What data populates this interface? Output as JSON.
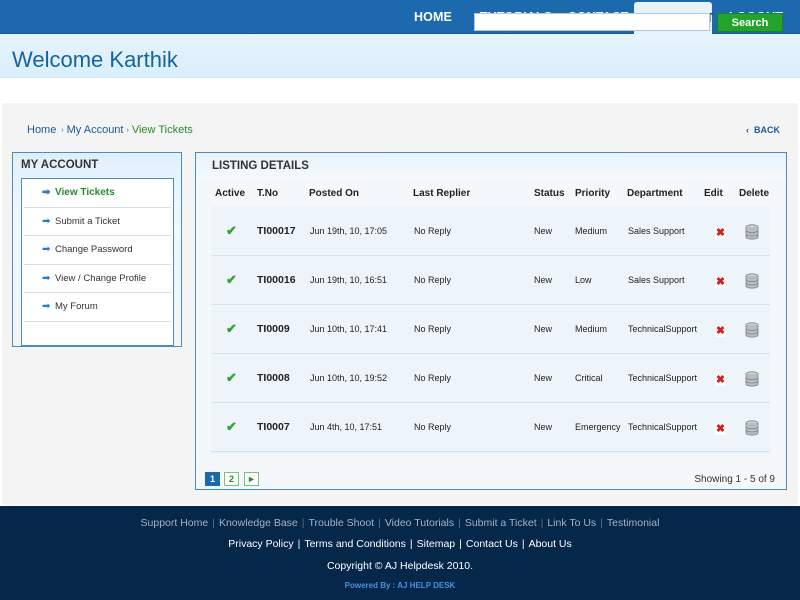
{
  "nav": {
    "items": [
      {
        "label": "HOME"
      },
      {
        "label": "TUTORIALS"
      },
      {
        "label": "CONTACT"
      },
      {
        "label": "MYACCOUNT"
      },
      {
        "label": "LOGOUT"
      }
    ],
    "active": "MYACCOUNT"
  },
  "header": {
    "welcome": "Welcome Karthik",
    "search_value": "",
    "search_button": "Search"
  },
  "breadcrumb": {
    "home": "Home",
    "myaccount": "My Account",
    "current": "View Tickets",
    "back": "BACK"
  },
  "sidebar": {
    "title": "MY ACCOUNT",
    "items": [
      {
        "label": "View Tickets"
      },
      {
        "label": "Submit a Ticket"
      },
      {
        "label": "Change Password"
      },
      {
        "label": "View / Change Profile"
      },
      {
        "label": "My Forum"
      }
    ]
  },
  "listing": {
    "title": "LISTING DETAILS",
    "columns": [
      "Active",
      "T.No",
      "Posted On",
      "Last Replier",
      "Status",
      "Priority",
      "Department",
      "Edit",
      "Delete"
    ],
    "rows": [
      {
        "tno": "TI00017",
        "posted": "Jun 19th, 10, 17:05",
        "replier": "No Reply",
        "status": "New",
        "priority": "Medium",
        "department": "Sales Support"
      },
      {
        "tno": "TI00016",
        "posted": "Jun 19th, 10, 16:51",
        "replier": "No Reply",
        "status": "New",
        "priority": "Low",
        "department": "Sales Support"
      },
      {
        "tno": "TI0009",
        "posted": "Jun 10th, 10, 17:41",
        "replier": "No Reply",
        "status": "New",
        "priority": "Medium",
        "department": "TechnicalSupport"
      },
      {
        "tno": "TI0008",
        "posted": "Jun 10th, 10, 19:52",
        "replier": "No Reply",
        "status": "New",
        "priority": "Critical",
        "department": "TechnicalSupport"
      },
      {
        "tno": "TI0007",
        "posted": "Jun 4th, 10, 17:51",
        "replier": "No Reply",
        "status": "New",
        "priority": "Emergency",
        "department": "TechnicalSupport"
      }
    ],
    "pagination": {
      "pages": [
        "1",
        "2"
      ],
      "next": "►",
      "current": "1"
    },
    "showing": "Showing 1 - 5 of 9"
  },
  "footer": {
    "links1": [
      "Support Home",
      "Knowledge Base",
      "Trouble Shoot",
      "Video Tutorials",
      "Submit a Ticket",
      "Link To Us",
      "Testimonial"
    ],
    "links2": [
      "Privacy Policy",
      "Terms and Conditions",
      "Sitemap",
      "Contact Us",
      "About Us"
    ],
    "copyright": "Copyright © AJ Helpdesk 2010.",
    "powered": "Powered By : AJ HELP DESK"
  },
  "icons": {
    "active": "check-icon",
    "edit": "red-x-icon",
    "delete": "database-icon",
    "sidebar_arrow": "blue-arrow-icon"
  },
  "colors": {
    "nav_bg": "#1c6aad",
    "accent_green": "#22a32d",
    "footer_bg": "#04274a",
    "link_blue": "#1a5a99"
  }
}
